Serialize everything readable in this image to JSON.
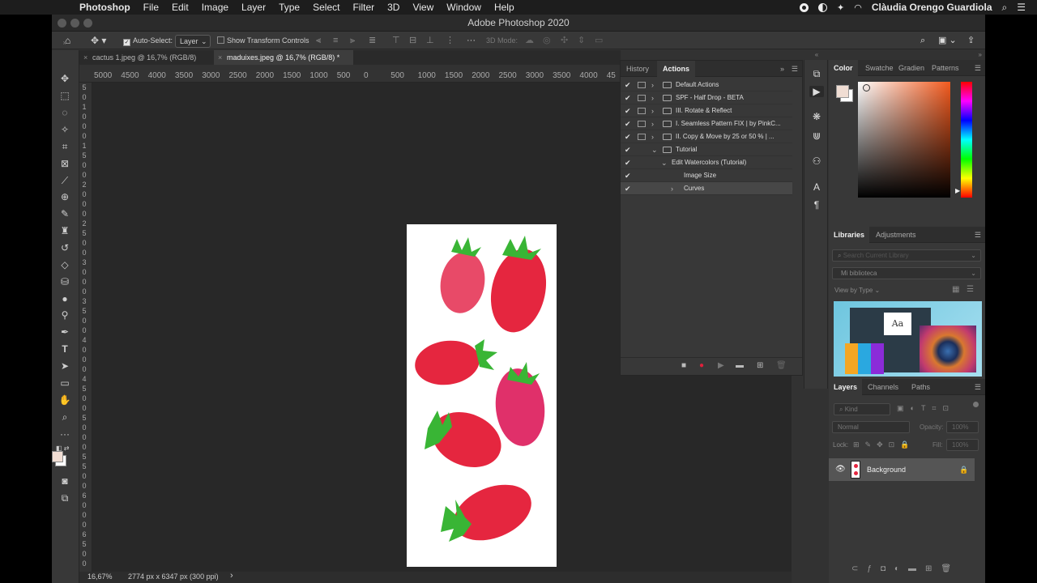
{
  "menubar": {
    "app_name": "Photoshop",
    "items": [
      "File",
      "Edit",
      "Image",
      "Layer",
      "Type",
      "Select",
      "Filter",
      "3D",
      "View",
      "Window",
      "Help"
    ],
    "user": "Clàudia Orengo Guardiola"
  },
  "window": {
    "title": "Adobe Photoshop 2020"
  },
  "options": {
    "auto_select_label": "Auto-Select:",
    "auto_select_value": "Layer",
    "transform_label": "Show Transform Controls",
    "mode_3d": "3D Mode:",
    "more": "···"
  },
  "tabs": [
    {
      "close": "×",
      "label": "cactus 1.jpeg @ 16,7% (RGB/8)"
    },
    {
      "close": "×",
      "label": "maduixes.jpeg @ 16,7% (RGB/8) *"
    }
  ],
  "ruler": {
    "h": [
      "5000",
      "4500",
      "4000",
      "3500",
      "3000",
      "2500",
      "2000",
      "1500",
      "1000",
      "500",
      "0",
      "500",
      "1000",
      "1500",
      "2000",
      "2500",
      "3000",
      "3500",
      "4000",
      "45"
    ],
    "v": [
      "5",
      "0",
      "1",
      "0",
      "0",
      "0",
      "1",
      "5",
      "0",
      "0",
      "2",
      "0",
      "0",
      "0",
      "2",
      "5",
      "0",
      "0",
      "3",
      "0",
      "0",
      "0",
      "3",
      "5",
      "0",
      "0",
      "4",
      "0",
      "0",
      "0",
      "4",
      "5",
      "0",
      "0",
      "5",
      "0",
      "0",
      "0",
      "5",
      "5",
      "0",
      "0",
      "6",
      "0",
      "0",
      "0",
      "6",
      "5",
      "0",
      "0"
    ]
  },
  "status": {
    "zoom": "16,67%",
    "size": "2774 px x 6347 px (300 ppi)",
    "arrow": "›"
  },
  "actions_panel": {
    "tabs": [
      "History",
      "Actions"
    ],
    "rows": [
      {
        "label": "Default Actions",
        "level": 0,
        "check": "✔",
        "toggle": true,
        "twisty": "›",
        "folder": true
      },
      {
        "label": "SPF - Half Drop - BETA",
        "level": 0,
        "check": "✔",
        "toggle": true,
        "twisty": "›",
        "folder": true
      },
      {
        "label": "III. Rotate & Reflect",
        "level": 0,
        "check": "✔",
        "toggle": true,
        "twisty": "›",
        "folder": true
      },
      {
        "label": "I. Seamless Pattern FIX  |  by PinkC...",
        "level": 0,
        "check": "✔",
        "toggle": true,
        "twisty": "›",
        "folder": true
      },
      {
        "label": "II. Copy & Move  by  25  or 50 %  |  ...",
        "level": 0,
        "check": "✔",
        "toggle": true,
        "twisty": "›",
        "folder": true
      },
      {
        "label": "Tutorial",
        "level": 0,
        "check": "✔",
        "toggle": false,
        "twisty": "⌄",
        "folder": true
      },
      {
        "label": "Edit Watercolors (Tutorial)",
        "level": 1,
        "check": "✔",
        "toggle": false,
        "twisty": "⌄",
        "folder": false
      },
      {
        "label": "Image Size",
        "level": 2,
        "check": "✔",
        "toggle": false,
        "twisty": "",
        "folder": false
      },
      {
        "label": "Curves",
        "level": 2,
        "check": "✔",
        "toggle": false,
        "twisty": "›",
        "folder": false,
        "selected": true
      }
    ],
    "bottom_icons": [
      "stop-icon",
      "record-icon",
      "play-icon",
      "folder-icon",
      "new-icon",
      "trash-icon"
    ]
  },
  "color_panel": {
    "tabs": [
      "Color",
      "Swatche",
      "Gradien",
      "Patterns"
    ],
    "foreground": "#f0ddd3",
    "background": "#ffffff"
  },
  "libraries_panel": {
    "tabs": [
      "Libraries",
      "Adjustments"
    ],
    "search_placeholder": "Search Current Library",
    "library": "Mi biblioteca",
    "view_by": "View by Type",
    "sample_text": "Aa"
  },
  "layers_panel": {
    "tabs": [
      "Layers",
      "Channels",
      "Paths"
    ],
    "kind": "Kind",
    "blend": "Normal",
    "opacity_label": "Opacity:",
    "opacity": "100%",
    "lock_label": "Lock:",
    "fill_label": "Fill:",
    "fill": "100%",
    "layers": [
      {
        "name": "Background",
        "visible": true,
        "locked": true
      }
    ]
  },
  "colors": {
    "accent": "#e0203b",
    "strawberry": "#e5263f",
    "leaf": "#39b535"
  }
}
